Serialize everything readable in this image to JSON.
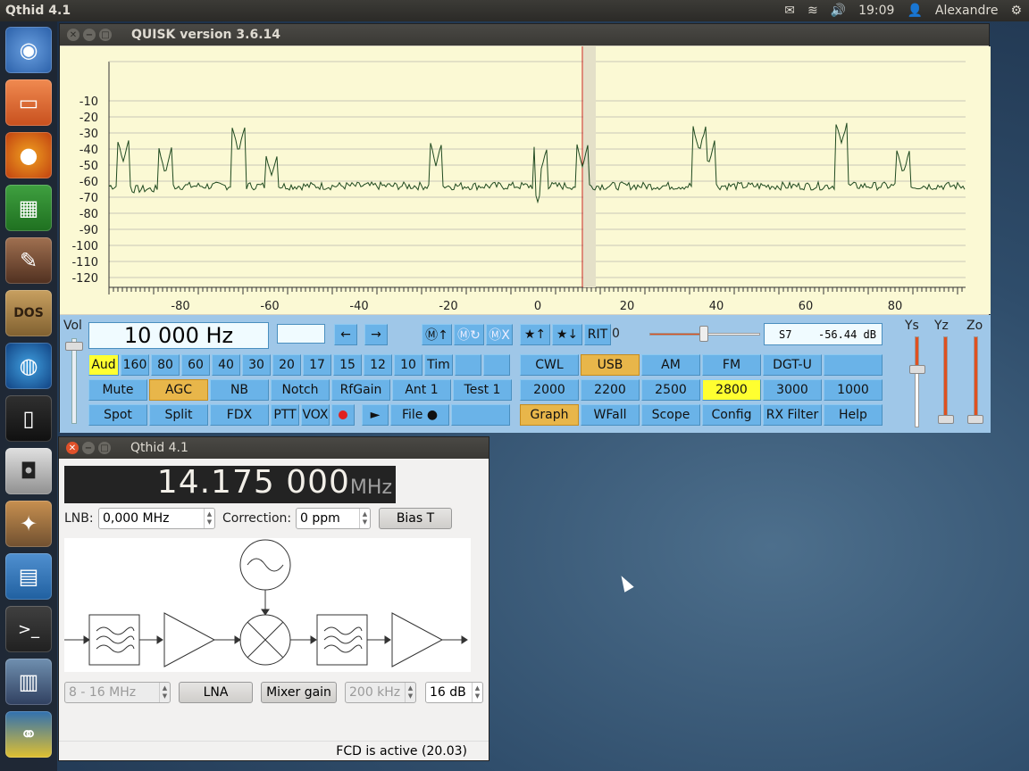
{
  "topbar": {
    "app_title": "Qthid 4.1",
    "time": "19:09",
    "user": "Alexandre"
  },
  "launcher": {
    "items": [
      "ubuntu-dash",
      "files",
      "firefox",
      "spreadsheet",
      "gimp-feather",
      "dosbox",
      "globe",
      "device",
      "camera-app",
      "gimp",
      "writer",
      "terminal",
      "radio",
      "python"
    ]
  },
  "quisk": {
    "title": "QUISK version 3.6.14",
    "y_ticks": [
      "-10",
      "-20",
      "-30",
      "-40",
      "-50",
      "-60",
      "-70",
      "-80",
      "-90",
      "-100",
      "-110",
      "-120"
    ],
    "x_ticks": [
      "-80",
      "-60",
      "-40",
      "-20",
      "0",
      "20",
      "40",
      "60",
      "80"
    ],
    "vol_label": "Vol",
    "freq": "10 000 Hz",
    "arrow_left": "←",
    "arrow_right": "→",
    "mem": [
      "Ⓜ↑",
      "Ⓜ↻",
      "ⓂX"
    ],
    "star_up": "★↑",
    "star_down": "★↓",
    "rit": "RIT",
    "rit_value": "0",
    "smeter": "S7",
    "smeter_db": "-56.44 dB",
    "ys": "Ys",
    "yz": "Yz",
    "zo": "Zo",
    "row1": [
      "Aud",
      "160",
      "80",
      "60",
      "40",
      "30",
      "20",
      "17",
      "15",
      "12",
      "10",
      "Tim",
      "",
      ""
    ],
    "row2": [
      "Mute",
      "AGC",
      "NB",
      "Notch",
      "RfGain",
      "Ant 1",
      "Test 1"
    ],
    "row3": [
      "Spot",
      "Split",
      "FDX",
      "PTT",
      "VOX",
      "",
      "►",
      "File ●",
      ""
    ],
    "modes": [
      "CWL",
      "USB",
      "AM",
      "FM",
      "DGT-U",
      ""
    ],
    "filters": [
      "2000",
      "2200",
      "2500",
      "2800",
      "3000",
      "1000"
    ],
    "views": [
      "Graph",
      "WFall",
      "Scope",
      "Config",
      "RX Filter",
      "Help"
    ]
  },
  "qthid": {
    "title": "Qthid 4.1",
    "freq_big": "14.175 000",
    "freq_unit": "MHz",
    "lnb_label": "LNB:",
    "lnb_value": "0,000 MHz",
    "corr_label": "Correction:",
    "corr_value": "0 ppm",
    "bias_t": "Bias T",
    "band": "8 - 16 MHz",
    "lna": "LNA",
    "mixer_gain": "Mixer gain",
    "if_bw": "200 kHz",
    "if_gain": "16 dB",
    "status": "FCD is active (20.03)"
  }
}
